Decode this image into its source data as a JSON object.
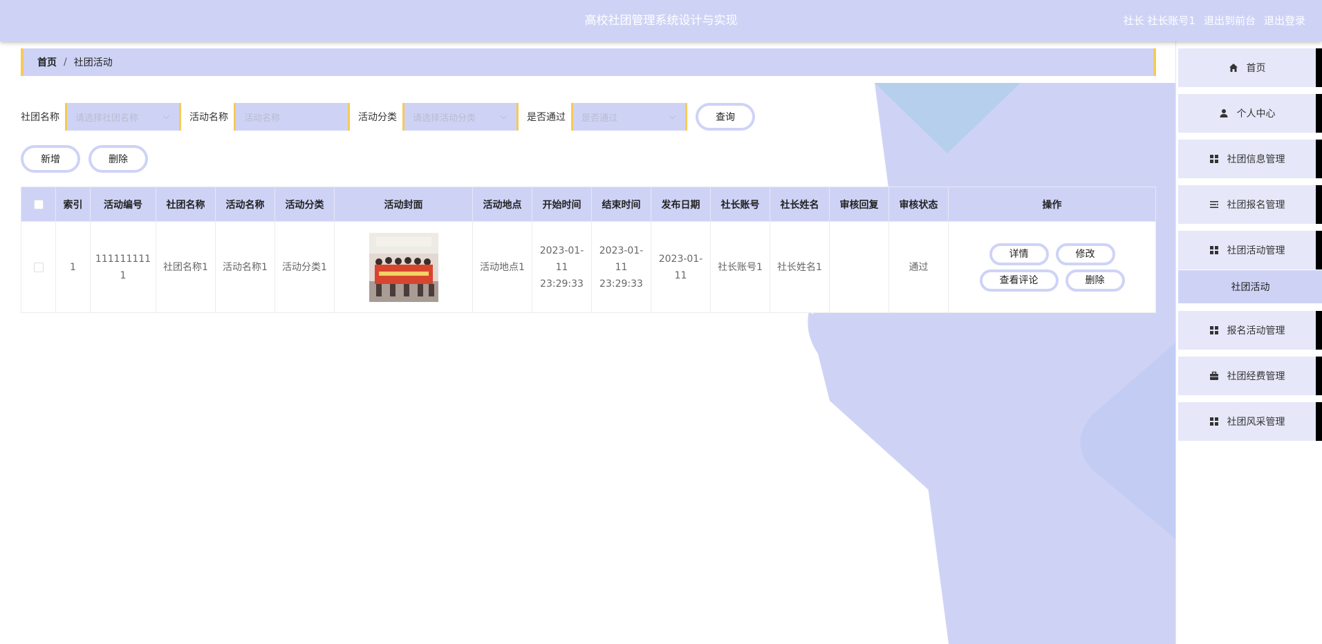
{
  "header": {
    "title": "高校社团管理系统设计与实现",
    "role": "社长",
    "account": "社长账号1",
    "to_front": "退出到前台",
    "logout": "退出登录"
  },
  "breadcrumb": {
    "home": "首页",
    "sep": "/",
    "current": "社团活动"
  },
  "search": {
    "club_label": "社团名称",
    "club_placeholder": "请选择社团名称",
    "activity_label": "活动名称",
    "activity_placeholder": "活动名称",
    "category_label": "活动分类",
    "category_placeholder": "请选择活动分类",
    "pass_label": "是否通过",
    "pass_placeholder": "是否通过",
    "query_button": "查询"
  },
  "actions": {
    "add": "新增",
    "delete": "删除"
  },
  "table": {
    "headers": [
      "索引",
      "活动编号",
      "社团名称",
      "活动名称",
      "活动分类",
      "活动封面",
      "活动地点",
      "开始时间",
      "结束时间",
      "发布日期",
      "社长账号",
      "社长姓名",
      "审核回复",
      "审核状态",
      "操作"
    ],
    "rows": [
      {
        "index": "1",
        "activity_no": "1111111111",
        "club_name": "社团名称1",
        "activity_name": "活动名称1",
        "category": "活动分类1",
        "location": "活动地点1",
        "start_time": "2023-01-11 23:29:33",
        "end_time": "2023-01-11 23:29:33",
        "publish_date": "2023-01-11",
        "leader_account": "社长账号1",
        "leader_name": "社长姓名1",
        "review_reply": "",
        "review_status": "通过",
        "ops": {
          "detail": "详情",
          "edit": "修改",
          "comments": "查看评论",
          "delete": "删除"
        }
      }
    ]
  },
  "sidebar": {
    "items": [
      {
        "label": "首页",
        "icon": "home-icon"
      },
      {
        "label": "个人中心",
        "icon": "user-icon"
      },
      {
        "label": "社团信息管理",
        "icon": "grid-icon"
      },
      {
        "label": "社团报名管理",
        "icon": "list-icon"
      },
      {
        "label": "社团活动管理",
        "icon": "grid-icon"
      },
      {
        "label": "报名活动管理",
        "icon": "grid-icon"
      },
      {
        "label": "社团经费管理",
        "icon": "briefcase-icon"
      },
      {
        "label": "社团风采管理",
        "icon": "grid-icon"
      }
    ],
    "sub_active": "社团活动"
  },
  "colors": {
    "accent": "#ced3f6",
    "highlight": "#f7ca55",
    "deco_light": "#b6cfec"
  }
}
